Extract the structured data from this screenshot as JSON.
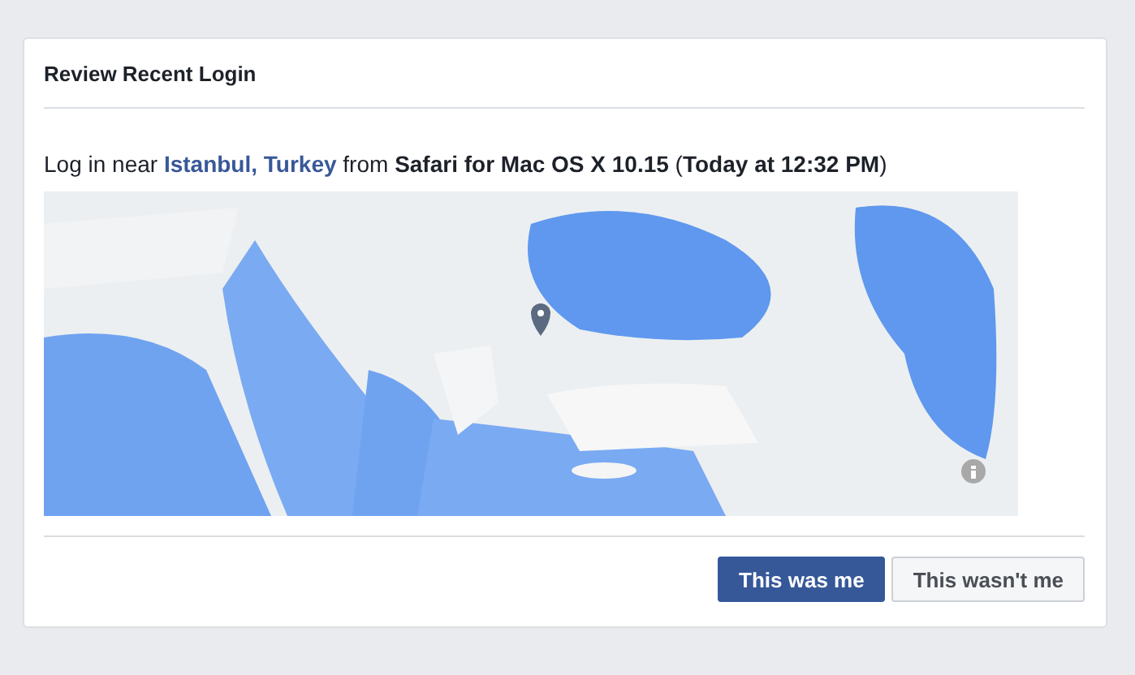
{
  "card": {
    "title": "Review Recent Login",
    "message": {
      "before": "Log in near ",
      "location": "Istanbul, Turkey",
      "after": " from **Safari for Mac OS X 10.15** (**Today at 12:32 PM**)"
    },
    "buttons": [
      {
        "label": "This was me",
        "kind": "primary"
      },
      {
        "label": "This wasn't me",
        "kind": "secondary"
      }
    ]
  }
}
